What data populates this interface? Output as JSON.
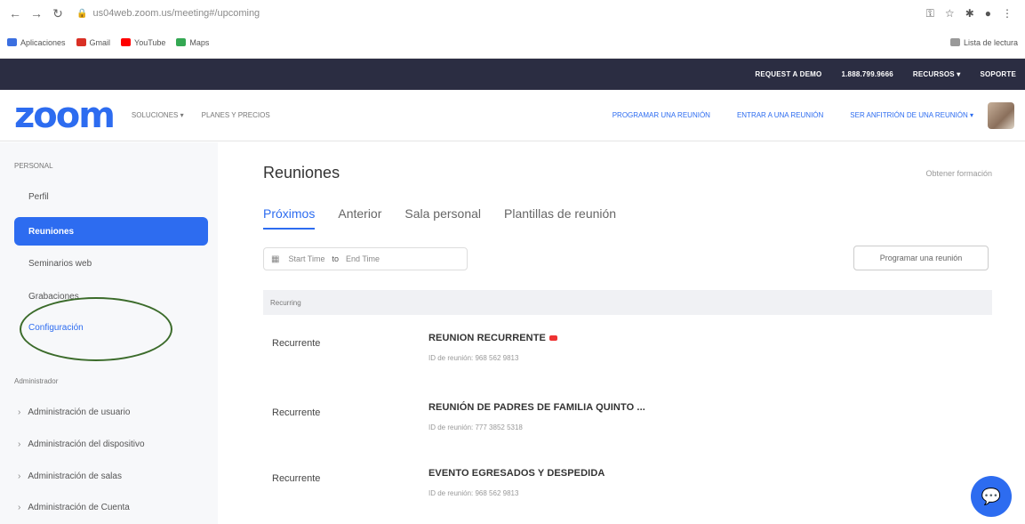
{
  "browser": {
    "url": "us04web.zoom.us/meeting#/upcoming",
    "bookmarks": [
      "Aplicaciones",
      "Gmail",
      "YouTube",
      "Maps"
    ],
    "reading_list": "Lista de lectura"
  },
  "topbar": {
    "links": [
      "REQUEST A DEMO",
      "1.888.799.9666",
      "RECURSOS ▾",
      "SOPORTE"
    ]
  },
  "header": {
    "logo": "zoom",
    "nav_left": [
      "SOLUCIONES ▾",
      "PLANES Y PRECIOS"
    ],
    "nav_right": [
      "PROGRAMAR UNA REUNIÓN",
      "ENTRAR A UNA REUNIÓN",
      "SER ANFITRIÓN DE UNA REUNIÓN ▾"
    ]
  },
  "sidebar": {
    "personal_label": "PERSONAL",
    "items": [
      {
        "label": "Perfil"
      },
      {
        "label": "Reuniones"
      },
      {
        "label": "Seminarios web"
      },
      {
        "label": "Grabaciones"
      },
      {
        "label": "Configuración"
      }
    ],
    "admin_label": "Administrador",
    "admin_items": [
      "Administración de usuario",
      "Administración del dispositivo",
      "Administración de salas",
      "Administración de Cuenta"
    ]
  },
  "main": {
    "title": "Reuniones",
    "help": "Obtener formación",
    "tabs": [
      "Próximos",
      "Anterior",
      "Sala personal",
      "Plantillas de reunión"
    ],
    "date_from": "Start Time",
    "date_sep": "to",
    "date_to": "End Time",
    "schedule_button": "Programar una reunión",
    "group_label": "Recurring",
    "meetings": [
      {
        "type": "Recurrente",
        "title": "REUNION RECURRENTE",
        "id_text": "ID de reunión: 968 562 9813"
      },
      {
        "type": "Recurrente",
        "title": "REUNIÓN DE PADRES DE FAMILIA QUINTO ...",
        "id_text": "ID de reunión: 777 3852 5318"
      },
      {
        "type": "Recurrente",
        "title": "EVENTO EGRESADOS Y DESPEDIDA",
        "id_text": "ID de reunión: 968 562 9813"
      }
    ]
  },
  "colors": {
    "accent": "#2d6cf0",
    "topbar": "#2b2d42",
    "annotation": "#3b6b2a"
  }
}
